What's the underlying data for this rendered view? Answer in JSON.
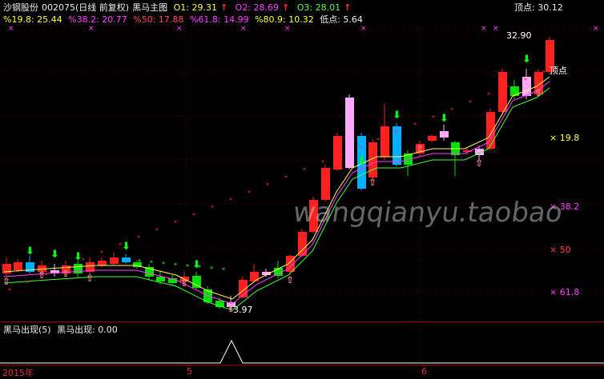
{
  "header": {
    "stock_name": "沙钢股份",
    "stock_code": "002075",
    "mode": "(日线 前复权)",
    "indicator_name": "黑马主图",
    "o1": "O1: 29.31",
    "o2": "O2: 28.69",
    "o3": "O3: 28.01",
    "peak_top_right": "顶点: 30.12"
  },
  "fib_line": {
    "f19": "%19.8: 25.44",
    "f38": "%38.2: 20.77",
    "f50": "%50: 17.88",
    "f61": "%61.8: 14.99",
    "f80": "%80.9: 10.32",
    "low": "低点: 5.64"
  },
  "right_levels": {
    "l19": "19.8",
    "l38": "38.2",
    "l50": "50",
    "l61": "61.8"
  },
  "annotations": {
    "high_price": "32.90",
    "peak_label": "顶点",
    "low_price": "3.97"
  },
  "watermark": "wangqianyu.taobao",
  "sub_panel": {
    "title": "黑马出现(5)",
    "value": "黑马出现: 0.00"
  },
  "x_axis": {
    "year": "2015年",
    "m5": "5",
    "m6": "6"
  },
  "colors": {
    "up": "#ff2020",
    "down": "#00e000",
    "pink": "#ffaaff",
    "cyan": "#00b0ff",
    "ma_yellow": "#ffff60",
    "ma_magenta": "#ff40ff",
    "ma_green": "#40ff40"
  }
}
